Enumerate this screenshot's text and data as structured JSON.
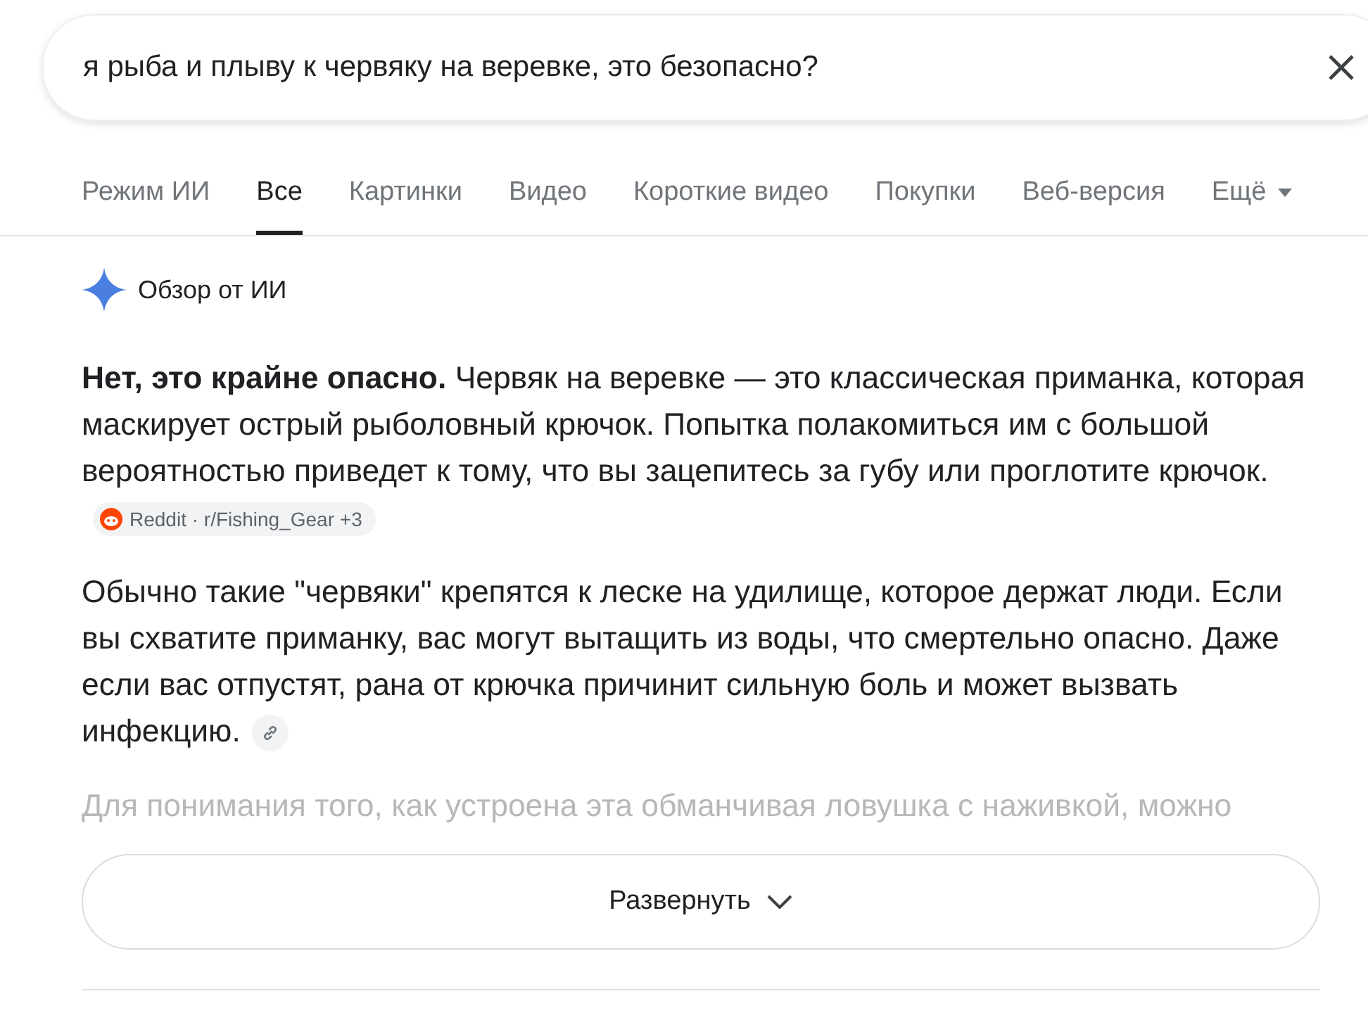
{
  "search": {
    "value": "я рыба и плыву к червяку на веревке, это безопасно?"
  },
  "tabs": [
    {
      "label": "Режим ИИ",
      "selected": false
    },
    {
      "label": "Все",
      "selected": true
    },
    {
      "label": "Картинки",
      "selected": false
    },
    {
      "label": "Видео",
      "selected": false
    },
    {
      "label": "Короткие видео",
      "selected": false
    },
    {
      "label": "Покупки",
      "selected": false
    },
    {
      "label": "Веб-версия",
      "selected": false
    },
    {
      "label": "Ещё",
      "selected": false,
      "kind": "menu"
    }
  ],
  "overview": {
    "title": "Обзор от ИИ",
    "paragraphs": [
      {
        "text": "**Нет, это крайне опасно.** Червяк на веревке — это классическая приманка, которая маскирует острый рыболовный крючок. Попытка полакомиться им с большой вероятностью приведет к тому, что вы зацепитесь за губу или проглотите крючок.",
        "citation": {
          "kind": "sources",
          "label": "Reddit · r/Fishing_Gear +3"
        }
      },
      {
        "text": "Обычно такие \"червяки\" крепятся к леске на удилище, которое держат люди. Если вы схватите приманку, вас могут вытащить из воды, что смертельно опасно. Даже если вас отпустят, рана от крючка причинит сильную боль и может вызвать инфекцию.",
        "citation": {
          "kind": "link"
        }
      }
    ],
    "faded_text": "Для понимания того, как устроена эта обманчивая ловушка с наживкой, можно",
    "expand_button": "Развернуть"
  }
}
